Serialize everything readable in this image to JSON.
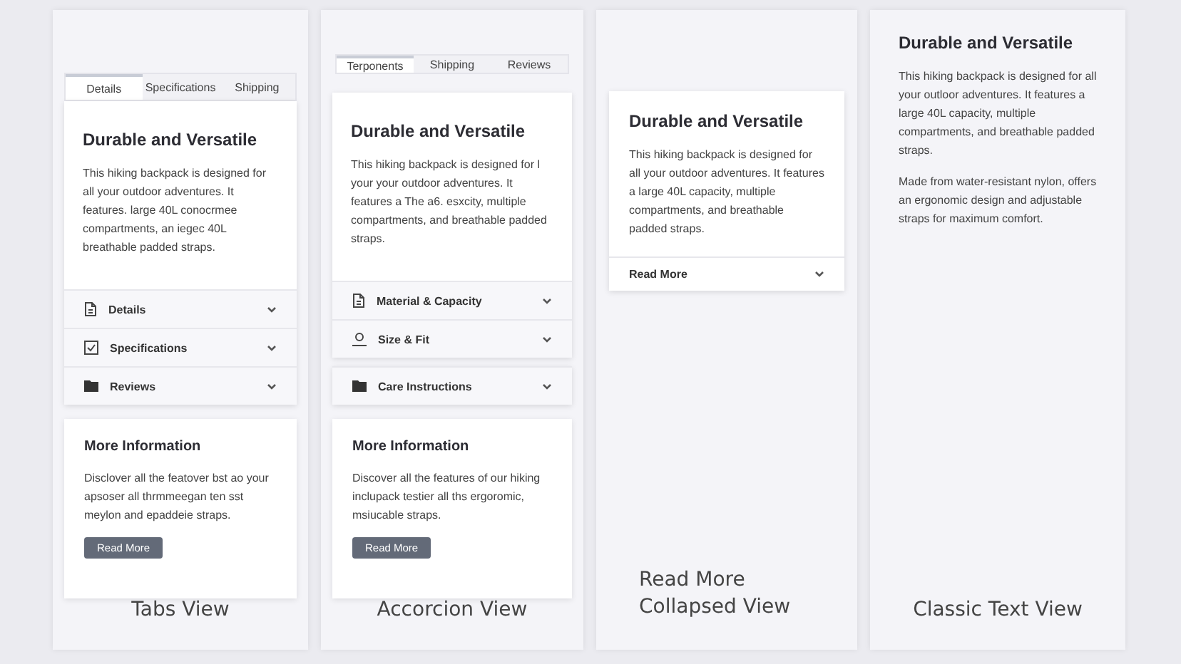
{
  "panels": [
    {
      "caption": "Tabs View",
      "blocks": [
        {
          "kind": "tabs",
          "tabs": [
            {
              "label": "Details",
              "selected": true
            },
            {
              "label": "Specifications",
              "selected": false
            },
            {
              "label": "Shipping",
              "selected": false
            }
          ]
        },
        {
          "kind": "card",
          "title": "Durable and Versatile",
          "paragraphs": [
            "This hiking backpack is designed for all your outdoor adventures. It features. large 40L conocrmee compartments, an iegec 40L breathable padded straps."
          ],
          "rows": [
            {
              "label": "Details"
            },
            {
              "label": "Specifications"
            },
            {
              "label": "Reviews"
            }
          ]
        },
        {
          "kind": "more",
          "title": "More Information",
          "text": "Disclover all the featover bst ao your apsoser all thrmmeegan ten sst meylon and epaddeie straps.",
          "button": "Read More"
        }
      ]
    },
    {
      "caption": "Accorcion View",
      "blocks": [
        {
          "kind": "tabs",
          "tabs": [
            {
              "label": "Terponents",
              "selected": true
            },
            {
              "label": "Shipping",
              "selected": false
            },
            {
              "label": "Reviews",
              "selected": false
            }
          ]
        },
        {
          "kind": "card",
          "title": "Durable and Versatile",
          "paragraphs": [
            "This hiking backpack is designed for l your your outdoor adventures. It features a The a6. esxcity, multiple compartments, and breathable padded straps."
          ],
          "rows": [
            {
              "label": "Material & Capacity"
            },
            {
              "label": "Size & Fit"
            }
          ]
        },
        {
          "kind": "rowcard",
          "rows": [
            {
              "label": "Care Instructions"
            }
          ]
        },
        {
          "kind": "more",
          "title": "More Information",
          "text": "Discover all the features of our hiking inclupack testier all ths ergoromic, msiucable straps.",
          "button": "Read More"
        }
      ]
    },
    {
      "caption": "Read More Collapsed View",
      "blocks": [
        {
          "kind": "readmore",
          "title": "Durable and Versatile",
          "paragraphs": [
            "This hiking backpack is designed for all your outdoor adventures. It features a large 40L capacity, multiple compartments, and breathable padded straps."
          ],
          "toggle": "Read More"
        }
      ]
    },
    {
      "caption": "Classic Text View",
      "blocks": [
        {
          "kind": "plain",
          "title": "Durable and Versatile",
          "paragraphs": [
            "This hiking backpack is designed for all your outloor adventures. It features a large 40L capacity, multiple compartments, and breathable padded straps.",
            "Made from water-resistant nylon, offers an ergonomic design and adjustable straps for maximum comfort."
          ]
        }
      ]
    }
  ]
}
